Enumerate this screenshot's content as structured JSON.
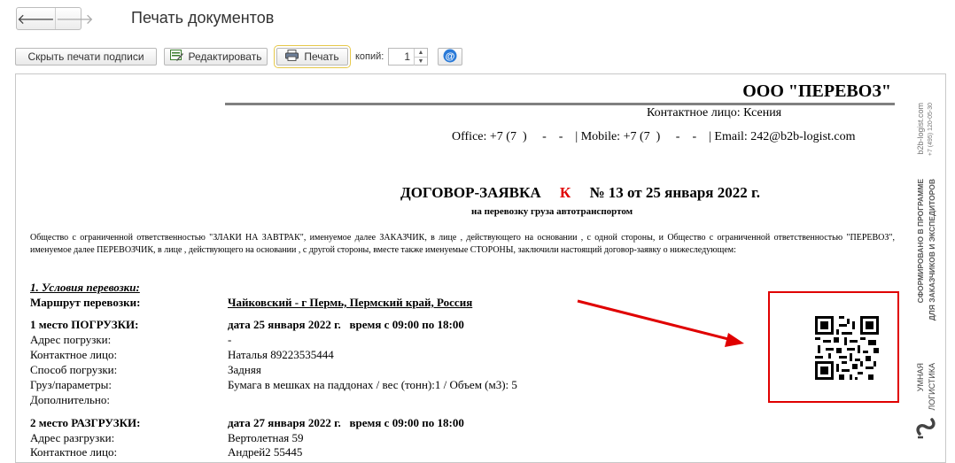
{
  "window": {
    "title": "Печать документов",
    "back_label": "🡐",
    "forward_label": "🡒"
  },
  "toolbar": {
    "hide_stamps_label": "Скрыть печати подписи",
    "edit_label": "Редактировать",
    "print_label": "Печать",
    "copies_label": "копий:",
    "copies_value": "1"
  },
  "doc": {
    "company": "ООО \"ПЕРЕВОЗ\"",
    "contact_person": "Контактное лицо: Ксения",
    "phones": "Office: +7 (7  )     -    -    | Mobile: +7 (7  )     -    -    | Email: 242@b2b-logist.com",
    "title_left": "ДОГОВОР-ЗАЯВКА",
    "title_mark": "К",
    "title_right": "№ 13 от 25 января 2022 г.",
    "subtitle": "на перевозку груза автотранспортом",
    "intro": "Общество с ограниченной ответственностью \"ЗЛАКИ НА ЗАВТРАК\", именуемое далее ЗАКАЗЧИК, в лице      , действующего на основании , с одной стороны, и Общество с ограниченной ответственностью \"ПЕРЕВОЗ\", именуемое далее ПЕРЕВОЗЧИК, в лице , действующего на основании , с другой стороны, вместе также именуемые СТОРОНЫ, заключили настоящий договор-заявку о нижеследующем:",
    "section1": "1. Условия перевозки:",
    "route_label": "Маршрут перевозки:",
    "route_value": "Чайковский - г Пермь,  Пермский край, Россия",
    "load_label": "1 место ПОГРУЗКИ:",
    "load_time": "дата 25 января 2022 г.   время с 09:00 по 18:00",
    "load_address_label": "Адрес погрузки:",
    "load_address_value": "-",
    "load_contact_label": "Контактное лицо:",
    "load_contact_value": "Наталья 89223535444",
    "load_method_label": "Способ погрузки:",
    "load_method_value": "Задняя",
    "cargo_label": "Груз/параметры:",
    "cargo_value": "Бумага в мешках на паддонах / вес (тонн):1 / Объем (м3): 5",
    "extra_label": "Дополнительно:",
    "unload_label": "2 место РАЗГРУЗКИ:",
    "unload_time": "дата 27 января 2022 г.   время с 09:00 по 18:00",
    "unload_address_label": "Адрес разгрузки:",
    "unload_address_value": "Вертолетная 59",
    "unload_contact_label": "Контактное лицо:",
    "unload_contact_value": "Андрей2 55445"
  },
  "sidebar_brand": {
    "site": "b2b-logist.com",
    "phone": "+7 (495) 120-05-30",
    "tagline1": "СФОРМИРОВАНО В ПРОГРАММЕ",
    "tagline2": "ДЛЯ ЗАКАЗЧИКОВ И ЭКСПЕДИТОРОВ",
    "brand1": "УМНАЯ",
    "brand2": "ЛОГИСТИКА"
  },
  "colors": {
    "accent_red": "#e00000",
    "focus_outline": "#e6c84a"
  }
}
